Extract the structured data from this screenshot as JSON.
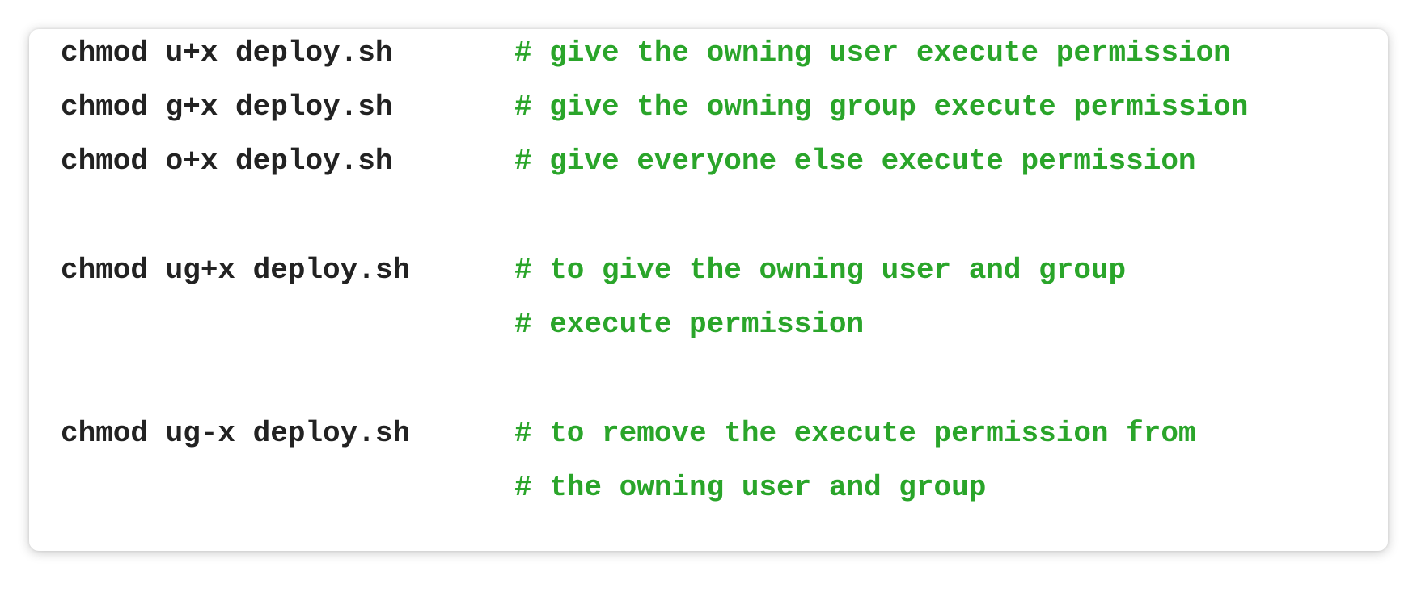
{
  "colors": {
    "command": "#222222",
    "comment": "#2aa52a",
    "background": "#ffffff"
  },
  "code": {
    "lines": [
      {
        "command": "chmod u+x deploy.sh",
        "comment": "# give the owning user execute permission"
      },
      {
        "command": "chmod g+x deploy.sh",
        "comment": "# give the owning group execute permission"
      },
      {
        "command": "chmod o+x deploy.sh",
        "comment": "# give everyone else execute permission"
      },
      {
        "command": "",
        "comment": ""
      },
      {
        "command": "chmod ug+x deploy.sh",
        "comment": "# to give the owning user and group"
      },
      {
        "command": "",
        "comment": "# execute permission"
      },
      {
        "command": "",
        "comment": ""
      },
      {
        "command": "chmod ug-x deploy.sh",
        "comment": "# to remove the execute permission from"
      },
      {
        "command": "",
        "comment": "# the owning user and group"
      }
    ]
  }
}
